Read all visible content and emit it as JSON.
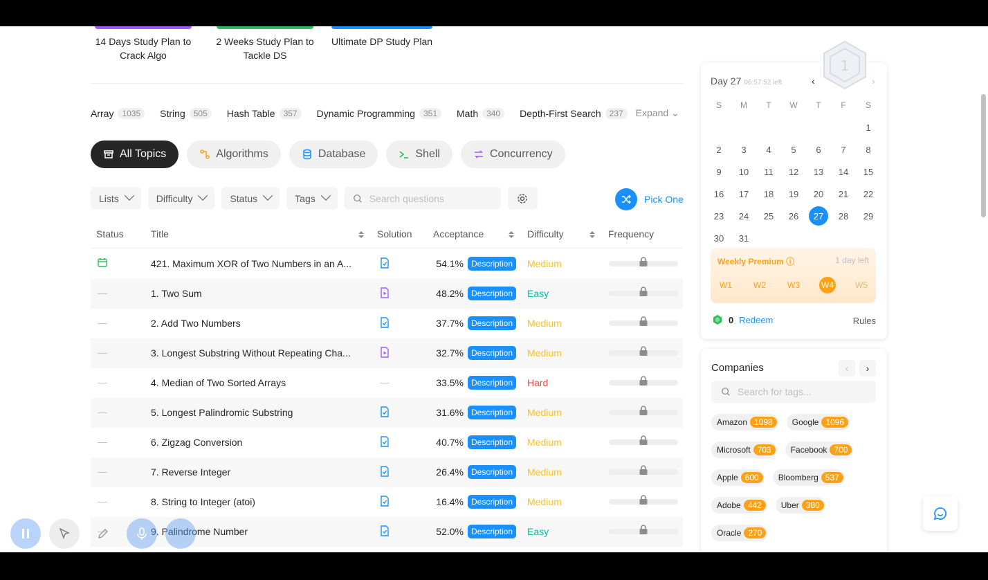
{
  "study_plans": [
    {
      "label": "14 Days Study Plan to Crack Algo",
      "color": "#a259ff"
    },
    {
      "label": "2 Weeks Study Plan to Tackle DS",
      "color": "#2cbb5d"
    },
    {
      "label": "Ultimate DP Study Plan",
      "color": "#1a90ff"
    }
  ],
  "topic_tags": [
    {
      "name": "Array",
      "count": "1035"
    },
    {
      "name": "String",
      "count": "505"
    },
    {
      "name": "Hash Table",
      "count": "357"
    },
    {
      "name": "Dynamic Programming",
      "count": "351"
    },
    {
      "name": "Math",
      "count": "340"
    },
    {
      "name": "Depth-First Search",
      "count": "237"
    }
  ],
  "expand_label": "Expand",
  "categories": [
    {
      "label": "All Topics",
      "icon": "layers-icon",
      "color": "#ffffff"
    },
    {
      "label": "Algorithms",
      "icon": "algorithm-icon",
      "color": "#ffa116"
    },
    {
      "label": "Database",
      "icon": "database-icon",
      "color": "#1a90ff"
    },
    {
      "label": "Shell",
      "icon": "terminal-icon",
      "color": "#2cbb5d"
    },
    {
      "label": "Concurrency",
      "icon": "concurrency-icon",
      "color": "#a259ff"
    }
  ],
  "filters": {
    "lists": "Lists",
    "difficulty": "Difficulty",
    "status": "Status",
    "tags": "Tags",
    "search_placeholder": "Search questions",
    "pick_one": "Pick One"
  },
  "table": {
    "headers": {
      "status": "Status",
      "title": "Title",
      "solution": "Solution",
      "acceptance": "Acceptance",
      "difficulty": "Difficulty",
      "frequency": "Frequency"
    },
    "badge_label": "Description",
    "rows": [
      {
        "status": "calendar",
        "title": "421. Maximum XOR of Two Numbers in an A...",
        "solution": "doc",
        "acceptance": "54.1%",
        "difficulty": "Medium"
      },
      {
        "status": "dash",
        "title": "1. Two Sum",
        "solution": "video",
        "acceptance": "48.2%",
        "difficulty": "Easy"
      },
      {
        "status": "dash",
        "title": "2. Add Two Numbers",
        "solution": "doc",
        "acceptance": "37.7%",
        "difficulty": "Medium"
      },
      {
        "status": "dash",
        "title": "3. Longest Substring Without Repeating Cha...",
        "solution": "video",
        "acceptance": "32.7%",
        "difficulty": "Medium"
      },
      {
        "status": "dash",
        "title": "4. Median of Two Sorted Arrays",
        "solution": "none",
        "acceptance": "33.5%",
        "difficulty": "Hard"
      },
      {
        "status": "dash",
        "title": "5. Longest Palindromic Substring",
        "solution": "doc",
        "acceptance": "31.6%",
        "difficulty": "Medium"
      },
      {
        "status": "dash",
        "title": "6. Zigzag Conversion",
        "solution": "doc",
        "acceptance": "40.7%",
        "difficulty": "Medium"
      },
      {
        "status": "dash",
        "title": "7. Reverse Integer",
        "solution": "doc",
        "acceptance": "26.4%",
        "difficulty": "Medium"
      },
      {
        "status": "dash",
        "title": "8. String to Integer (atoi)",
        "solution": "doc",
        "acceptance": "16.4%",
        "difficulty": "Medium"
      },
      {
        "status": "dash",
        "title": "9. Palindrome Number",
        "solution": "doc",
        "acceptance": "52.0%",
        "difficulty": "Easy"
      }
    ]
  },
  "difficulty_colors": {
    "Easy": "#00b8a3",
    "Medium": "#ffc01e",
    "Hard": "#ef4743"
  },
  "calendar": {
    "day_label": "Day 27",
    "time_left": "06:57:52 left",
    "weekdays": [
      "S",
      "M",
      "T",
      "W",
      "T",
      "F",
      "S"
    ],
    "lead_blanks": 6,
    "days_in_month": 31,
    "today": 27,
    "weekly_premium": {
      "title": "Weekly Premium",
      "left": "1 day left",
      "weeks": [
        "W1",
        "W2",
        "W3",
        "W4",
        "W5"
      ],
      "current": "W4"
    },
    "coins": "0",
    "redeem": "Redeem",
    "rules": "Rules"
  },
  "companies": {
    "title": "Companies",
    "search_placeholder": "Search for tags...",
    "items": [
      {
        "name": "Amazon",
        "count": "1098"
      },
      {
        "name": "Google",
        "count": "1096"
      },
      {
        "name": "Microsoft",
        "count": "703"
      },
      {
        "name": "Facebook",
        "count": "700"
      },
      {
        "name": "Apple",
        "count": "600"
      },
      {
        "name": "Bloomberg",
        "count": "537"
      },
      {
        "name": "Adobe",
        "count": "442"
      },
      {
        "name": "Uber",
        "count": "380"
      },
      {
        "name": "Oracle",
        "count": "270"
      }
    ]
  }
}
